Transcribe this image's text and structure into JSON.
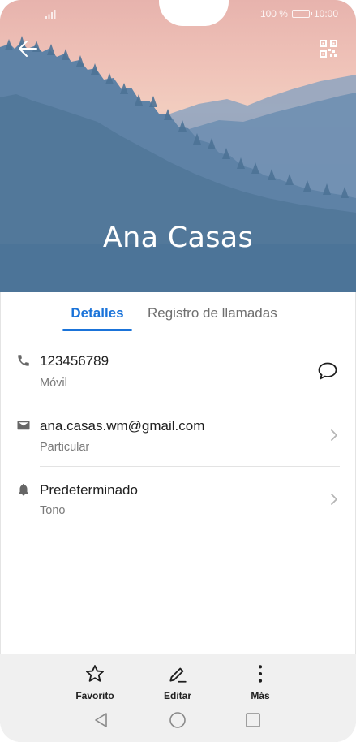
{
  "status_bar": {
    "battery_text": "100 %",
    "time": "10:00"
  },
  "header": {
    "contact_name": "Ana Casas"
  },
  "tabs": [
    {
      "label": "Detalles",
      "active": true
    },
    {
      "label": "Registro de llamadas",
      "active": false
    }
  ],
  "details": {
    "phone": {
      "number": "123456789",
      "type": "Móvil"
    },
    "email": {
      "address": "ana.casas.wm@gmail.com",
      "type": "Particular"
    },
    "ringtone": {
      "value": "Predeterminado",
      "label": "Tono"
    }
  },
  "actions": [
    {
      "label": "Favorito",
      "icon": "star-icon"
    },
    {
      "label": "Editar",
      "icon": "edit-icon"
    },
    {
      "label": "Más",
      "icon": "more-vertical-icon"
    }
  ],
  "navigation": [
    "back-triangle-icon",
    "home-circle-icon",
    "recents-square-icon"
  ],
  "colors": {
    "accent": "#1a73d9",
    "header_top": "#e7b3ad",
    "header_bottom": "#4f789f",
    "bottom_bar": "#f0f0f0"
  }
}
